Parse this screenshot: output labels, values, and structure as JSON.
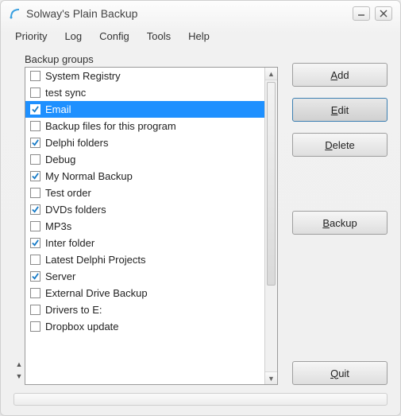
{
  "window": {
    "title": "Solway's Plain Backup"
  },
  "menu": [
    "Priority",
    "Log",
    "Config",
    "Tools",
    "Help"
  ],
  "group_label": "Backup groups",
  "items": [
    {
      "label": "System Registry",
      "checked": false,
      "selected": false
    },
    {
      "label": "test sync",
      "checked": false,
      "selected": false
    },
    {
      "label": "Email",
      "checked": true,
      "selected": true
    },
    {
      "label": "Backup files for this program",
      "checked": false,
      "selected": false
    },
    {
      "label": "Delphi folders",
      "checked": true,
      "selected": false
    },
    {
      "label": "Debug",
      "checked": false,
      "selected": false
    },
    {
      "label": "My Normal Backup",
      "checked": true,
      "selected": false
    },
    {
      "label": "Test order",
      "checked": false,
      "selected": false
    },
    {
      "label": "DVDs folders",
      "checked": true,
      "selected": false
    },
    {
      "label": "MP3s",
      "checked": false,
      "selected": false
    },
    {
      "label": "Inter folder",
      "checked": true,
      "selected": false
    },
    {
      "label": "Latest Delphi Projects",
      "checked": false,
      "selected": false
    },
    {
      "label": "Server",
      "checked": true,
      "selected": false
    },
    {
      "label": "External Drive Backup",
      "checked": false,
      "selected": false
    },
    {
      "label": "Drivers to E:",
      "checked": false,
      "selected": false
    },
    {
      "label": "Dropbox update",
      "checked": false,
      "selected": false
    }
  ],
  "buttons": {
    "add": {
      "pre": "",
      "u": "A",
      "post": "dd"
    },
    "edit": {
      "pre": "",
      "u": "E",
      "post": "dit"
    },
    "delete": {
      "pre": "",
      "u": "D",
      "post": "elete"
    },
    "backup": {
      "pre": "",
      "u": "B",
      "post": "ackup"
    },
    "quit": {
      "pre": "",
      "u": "Q",
      "post": "uit"
    }
  }
}
